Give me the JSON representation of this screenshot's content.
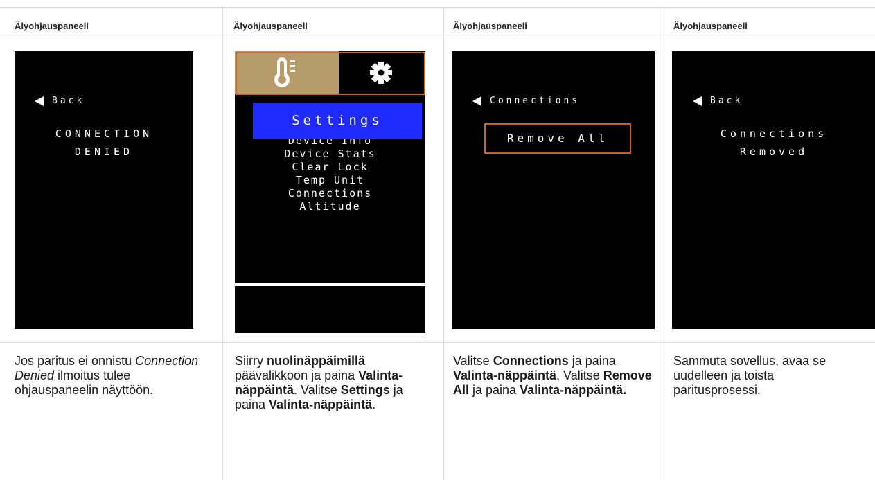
{
  "columns": [
    {
      "header": "Älyohjauspaneeli",
      "screen": {
        "back": "Back",
        "lines": [
          "CONNECTION",
          "DENIED"
        ]
      },
      "description": [
        {
          "t": "Jos paritus ei onnistu "
        },
        {
          "t": "Connection",
          "i": true
        },
        {
          "t": "\n"
        },
        {
          "t": "Denied",
          "i": true
        },
        {
          "t": " ilmoitus tulee ohjauspaneelin näyttöön."
        }
      ]
    },
    {
      "header": "Älyohjauspaneeli",
      "screen": {
        "tab_left_icon": "thermometer-icon",
        "tab_right_icon": "gear-icon",
        "selected": "Settings",
        "items": [
          "Device Info",
          "Device Stats",
          "Clear Lock",
          "Temp Unit",
          "Connections",
          "Altitude"
        ]
      },
      "description": [
        {
          "t": "Siirry "
        },
        {
          "t": "nuolinäppäimillä",
          "b": true
        },
        {
          "t": " päävalikkoon ja paina "
        },
        {
          "t": "Valinta-näppäintä",
          "b": true
        },
        {
          "t": ". Valitse "
        },
        {
          "t": "Settings",
          "b": true
        },
        {
          "t": " ja paina "
        },
        {
          "t": "Valinta-näppäintä",
          "b": true
        },
        {
          "t": "."
        }
      ]
    },
    {
      "header": "Älyohjauspaneeli",
      "screen": {
        "back": "Connections",
        "button": "Remove All"
      },
      "description": [
        {
          "t": "Valitse "
        },
        {
          "t": "Connections",
          "b": true
        },
        {
          "t": " ja paina "
        },
        {
          "t": "Valinta-näppäintä",
          "b": true
        },
        {
          "t": ". Valitse "
        },
        {
          "t": "Remove All",
          "b": true
        },
        {
          "t": " ja paina "
        },
        {
          "t": "Valinta-näppäintä.",
          "b": true
        }
      ]
    },
    {
      "header": "Älyohjauspaneeli",
      "screen": {
        "back": "Back",
        "lines": [
          "Connections",
          "Removed"
        ]
      },
      "description": [
        {
          "t": "Sammuta sovellus, avaa se uudelleen ja toista paritusprosessi."
        }
      ]
    }
  ],
  "colors": {
    "screen_bg": "#000000",
    "accent_orange": "#c1672a",
    "selection_blue": "#1f2bff",
    "tab_tan": "#b89b6b"
  }
}
